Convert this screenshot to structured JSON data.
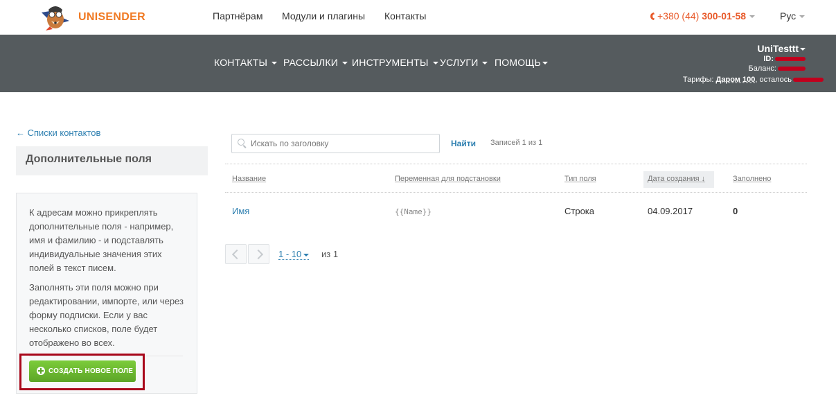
{
  "brand": {
    "name": "UNISENDER"
  },
  "topnav": {
    "items": [
      "Партнёрам",
      "Модули и плагины",
      "Контакты"
    ]
  },
  "phone": {
    "prefix": "+380 (44) ",
    "number": "300-01-58"
  },
  "lang": {
    "current": "Рус"
  },
  "mainnav": {
    "items": [
      "КОНТАКТЫ",
      "РАССЫЛКИ",
      "ИНСТРУМЕНТЫ",
      "УСЛУГИ",
      "ПОМОЩЬ"
    ]
  },
  "account": {
    "username": "UniTesttt",
    "id_label": "ID:",
    "balance_label": "Баланс:",
    "tariff_label": "Тарифы:",
    "tariff_name": "Даром 100",
    "remaining_label": ", осталось"
  },
  "sidebar": {
    "back_link": "← Списки контактов",
    "title": "Дополнительные поля",
    "info_p1": "К адресам можно прикреплять дополнительные поля - например, имя и фамилию - и подставлять индивидуальные значения этих полей в текст писем.",
    "info_p2": "Заполнять эти поля можно при редактировании, импорте, или через форму подписки. Если у вас несколько списков, поле будет отображено во всех.",
    "create_button": "СОЗДАТЬ НОВОЕ ПОЛЕ"
  },
  "search": {
    "placeholder": "Искать по заголовку",
    "find_label": "Найти",
    "records_text": "Записей 1 из 1"
  },
  "table": {
    "headers": {
      "name": "Название",
      "variable": "Переменная для подстановки",
      "type": "Тип поля",
      "date": "Дата создания",
      "filled": "Заполнено"
    },
    "rows": [
      {
        "name": "Имя",
        "variable": "{{Name}}",
        "type": "Строка",
        "date": "04.09.2017",
        "filled": "0"
      }
    ]
  },
  "pagination": {
    "range": "1 - 10",
    "of_text": "из 1"
  },
  "colors": {
    "brand_orange": "#f07a24",
    "nav_dark": "#555b5e",
    "link_blue": "#2d7fb0",
    "button_green": "#5ca527",
    "highlight_red": "#a8071a"
  },
  "icons": {
    "logo": "fox-pilot-logo",
    "phone": "phone-icon",
    "search": "search-icon",
    "plus": "plus-circle-icon",
    "prev": "chevron-left-icon",
    "next": "chevron-right-icon",
    "sort": "arrow-down-icon"
  }
}
